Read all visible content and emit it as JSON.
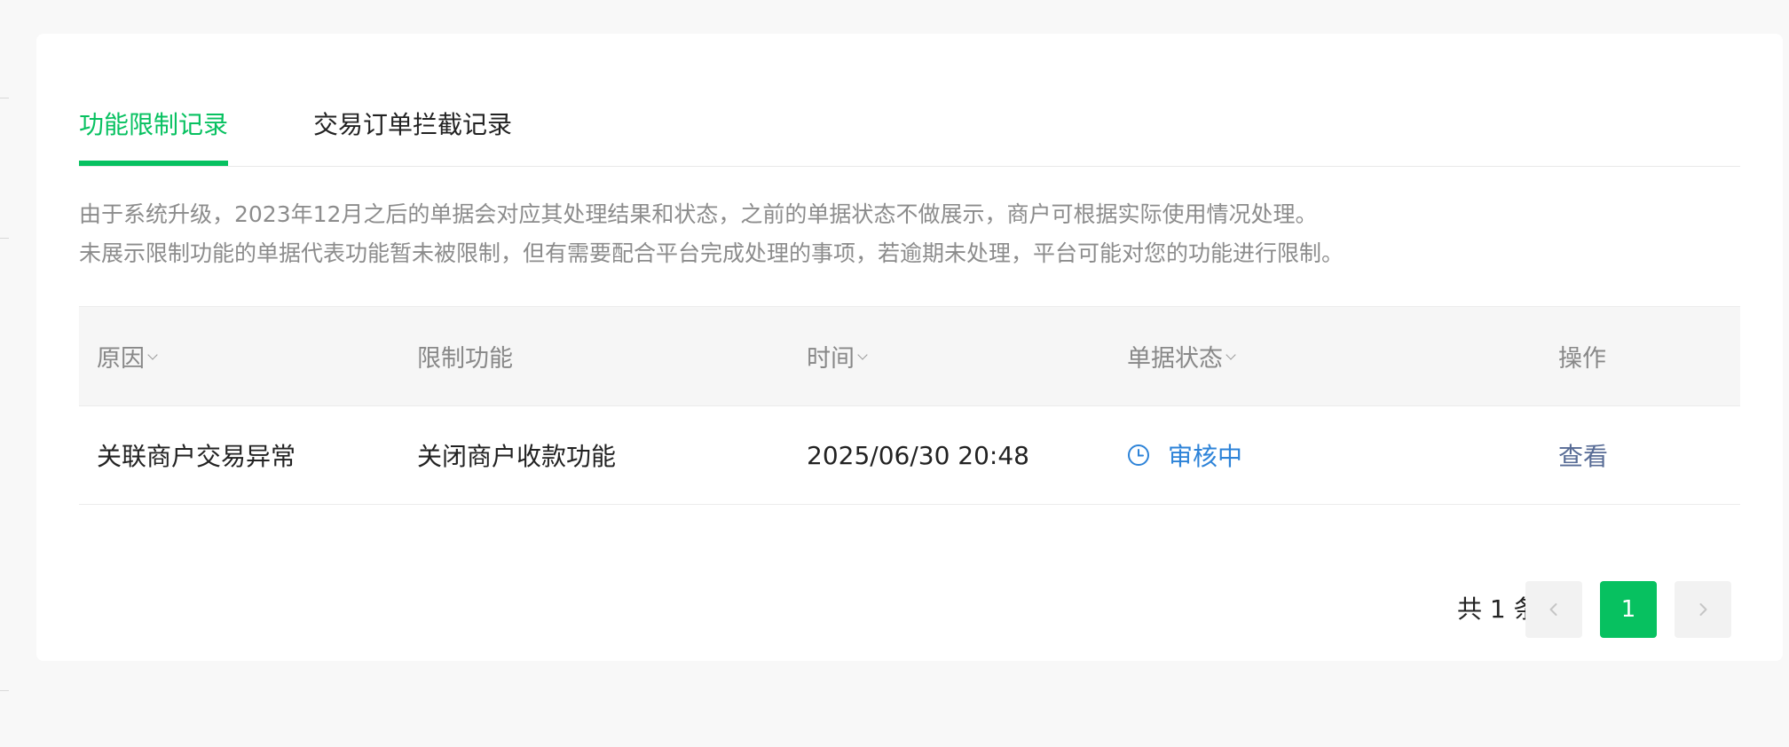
{
  "tabs": [
    {
      "label": "功能限制记录",
      "active": true
    },
    {
      "label": "交易订单拦截记录",
      "active": false
    }
  ],
  "notice": {
    "line1": "由于系统升级，2023年12月之后的单据会对应其处理结果和状态，之前的单据状态不做展示，商户可根据实际使用情况处理。",
    "line2": "未展示限制功能的单据代表功能暂未被限制，但有需要配合平台完成处理的事项，若逾期未处理，平台可能对您的功能进行限制。"
  },
  "table": {
    "headers": {
      "reason": "原因",
      "restricted_function": "限制功能",
      "time": "时间",
      "status": "单据状态",
      "action": "操作"
    },
    "rows": [
      {
        "reason": "关联商户交易异常",
        "restricted_function": "关闭商户收款功能",
        "time": "2025/06/30 20:48",
        "status": "审核中",
        "action": "查看"
      }
    ]
  },
  "pagination": {
    "total_label": "共 1 条",
    "current_page": "1"
  },
  "colors": {
    "accent": "#07c160",
    "status_pending": "#2d83d8",
    "link": "#576b95",
    "notice_text": "#8c8c8c"
  },
  "icons": {
    "status": "clock-icon",
    "sort": "chevron-down-icon",
    "prev": "chevron-left-icon",
    "next": "chevron-right-icon"
  }
}
